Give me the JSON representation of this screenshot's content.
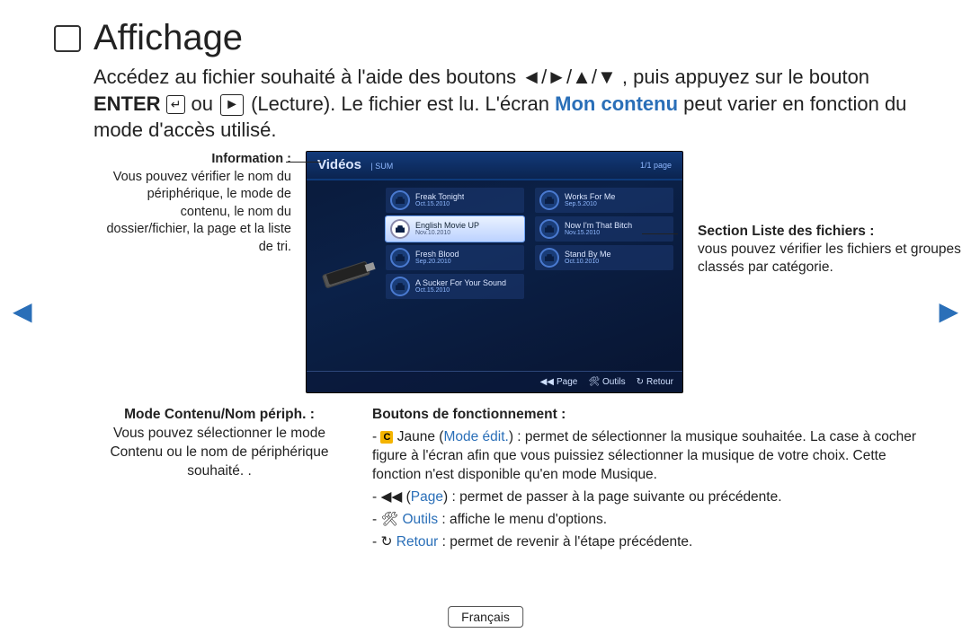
{
  "header": {
    "title": "Affichage"
  },
  "intro": {
    "part1": "Accédez au fichier souhaité à l'aide des boutons ",
    "arrows": "◄/►/▲/▼",
    "part2": ", puis appuyez sur le bouton ",
    "enter": "ENTER",
    "enter_glyph": "↵",
    "ou": " ou ",
    "play_glyph": "►",
    "part3": " (Lecture). Le fichier est lu. L'écran ",
    "mon_contenu": "Mon contenu",
    "part4": " peut varier en fonction du mode d'accès utilisé."
  },
  "left": {
    "info_head": "Information :",
    "info_body": "Vous pouvez vérifier le nom du périphérique, le mode de contenu, le nom du dossier/fichier, la page et la liste de tri."
  },
  "right": {
    "list_head": "Section Liste des fichiers :",
    "list_body": "vous pouvez vérifier les fichiers et groupes classés par catégorie."
  },
  "screen": {
    "title": "Vidéos",
    "sub": "| SUM",
    "page": "1/1 page",
    "files": [
      {
        "name": "Freak Tonight",
        "date": "Oct.15.2010",
        "sel": false
      },
      {
        "name": "Works For Me",
        "date": "Sep.5.2010",
        "sel": false
      },
      {
        "name": "English Movie UP",
        "date": "Nov.10.2010",
        "sel": true
      },
      {
        "name": "Now I'm That Bitch",
        "date": "Nov.15.2010",
        "sel": false
      },
      {
        "name": "Fresh Blood",
        "date": "Sep.20.2010",
        "sel": false
      },
      {
        "name": "Stand By Me",
        "date": "Oct.10.2010",
        "sel": false
      },
      {
        "name": "A Sucker For Your Sound",
        "date": "Oct.15.2010",
        "sel": false
      }
    ],
    "foot": {
      "page": "Page",
      "tools": "Outils",
      "return": "Retour"
    }
  },
  "below_left": {
    "head": "Mode Contenu/Nom périph. :",
    "body": "Vous pouvez sélectionner le mode Contenu ou le nom de périphérique souhaité. ."
  },
  "below_right": {
    "head": "Boutons de fonctionnement :",
    "c": "C",
    "jaune_pref": " Jaune (",
    "mode_edit": "Mode édit.",
    "jaune_suf": ") : permet de sélectionner la musique souhaitée. La case à cocher figure à l'écran afin que vous puissiez sélectionner la musique de votre choix. Cette fonction n'est disponible qu'en mode Musique.",
    "page_glyph": "◀◀",
    "page_label": "Page",
    "page_text": " : permet de passer à la page suivante ou précédente.",
    "tools_glyph": "🛠",
    "tools_label": "Outils",
    "tools_text": " : affiche le menu d'options.",
    "return_glyph": "↻",
    "return_label": "Retour",
    "return_text": " : permet de revenir à l'étape précédente."
  },
  "lang": "Français"
}
